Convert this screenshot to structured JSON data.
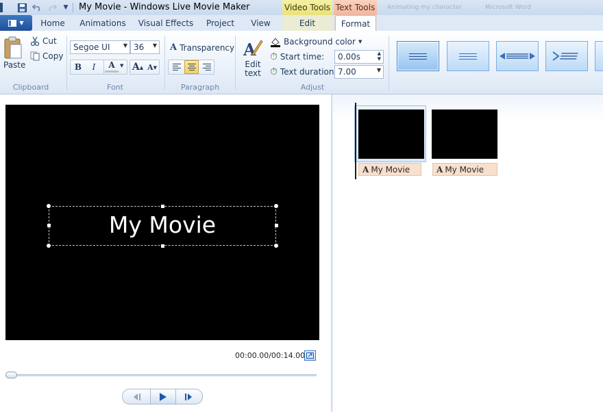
{
  "window": {
    "title": "My Movie - Windows Live Movie Maker",
    "context_groups": {
      "video_tools": "Video Tools",
      "text_tools": "Text Tools"
    },
    "blurred_tabs": [
      "Animating my character",
      "Microsoft Word"
    ]
  },
  "tabs": [
    {
      "label": "Home"
    },
    {
      "label": "Animations"
    },
    {
      "label": "Visual Effects"
    },
    {
      "label": "Project"
    },
    {
      "label": "View"
    },
    {
      "label": "Edit"
    },
    {
      "label": "Format"
    }
  ],
  "ribbon": {
    "clipboard": {
      "label": "Clipboard",
      "paste": "Paste",
      "cut": "Cut",
      "copy": "Copy"
    },
    "font": {
      "label": "Font",
      "family": "Segoe UI",
      "size": "36",
      "bold": "B",
      "italic": "I",
      "color": "A",
      "grow": "A",
      "shrink": "A"
    },
    "paragraph": {
      "label": "Paragraph",
      "transparency": "Transparency"
    },
    "adjust": {
      "label": "Adjust",
      "edit_text_line1": "Edit",
      "edit_text_line2": "text",
      "background_color": "Background color",
      "start_time_label": "Start time:",
      "start_time_value": "0.00s",
      "text_duration_label": "Text duration:",
      "text_duration_value": "7.00"
    }
  },
  "preview": {
    "title_text": "My Movie",
    "timecode": "00:00.00/00:14.00"
  },
  "storyboard": {
    "clips": [
      {
        "caption": "My Movie"
      },
      {
        "caption": "My Movie"
      }
    ]
  },
  "colors": {
    "accent": "#1f4f98",
    "video_tools": "#e9e27a",
    "text_tools": "#f2b79e",
    "caption_bg": "#f8e0cd"
  }
}
